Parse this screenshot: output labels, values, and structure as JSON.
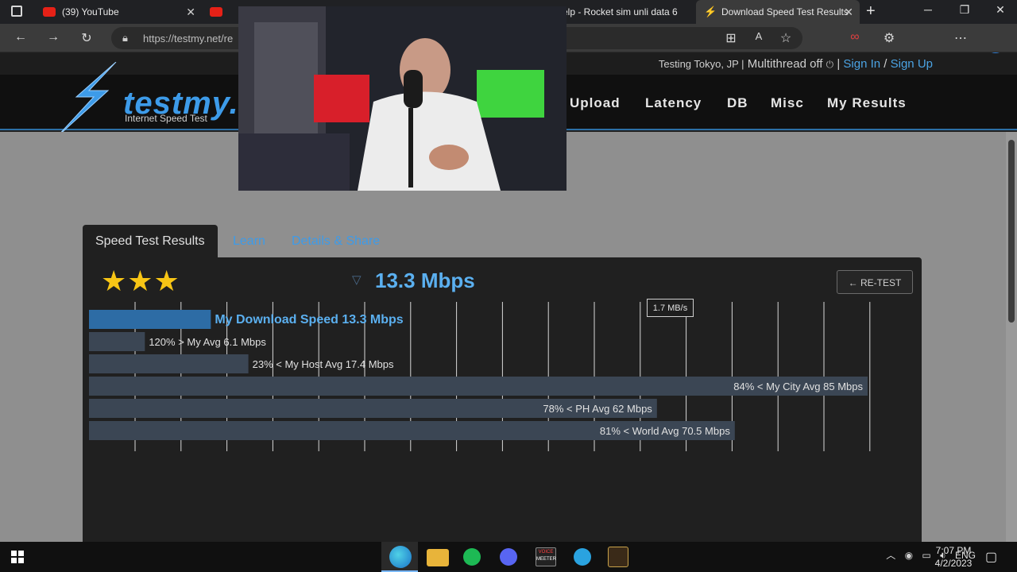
{
  "browser": {
    "tabs": [
      {
        "label": "(39) YouTube",
        "favicon": "youtube-icon"
      },
      {
        "label": "",
        "favicon": "youtube-icon"
      },
      {
        "label": "elp - Rocket sim unli data 6⁠",
        "favicon": ""
      },
      {
        "label": "Download Speed Test Results",
        "favicon": "testmy-icon"
      }
    ],
    "address": "https://testmy.net/re"
  },
  "site": {
    "status_prefix": "Testing Tokyo, JP |",
    "multithread": "Multithread off",
    "sign_in": "Sign In",
    "separator": "/",
    "sign_up": "Sign Up",
    "logo_text": "testmy.n",
    "logo_sub": "Internet Speed Test",
    "nav": [
      "Upload",
      "Latency",
      "DB",
      "Misc",
      "My Results"
    ]
  },
  "page": {
    "tabs": [
      "Speed Test Results",
      "Learn",
      "Details & Share"
    ],
    "stars": "★★★",
    "speed": "13.3 Mbps",
    "retest": "← RE-TEST",
    "tooltip": "1.7 MB/s"
  },
  "chart_data": {
    "type": "bar",
    "orientation": "horizontal",
    "categories": [
      "My Download Speed 13.3 Mbps",
      "120% > My Avg 6.1 Mbps",
      "23% < My Host Avg 17.4 Mbps",
      "84% < My City Avg 85 Mbps",
      "78% < PH Avg 62 Mbps",
      "81% < World Avg 70.5 Mbps"
    ],
    "values": [
      13.3,
      6.1,
      17.4,
      85,
      62,
      70.5
    ],
    "xlim": [
      0,
      85
    ],
    "grid": true,
    "colors": [
      "#2d6ca5",
      "#3b4654",
      "#3b4654",
      "#3b4654",
      "#3b4654",
      "#3b4654"
    ]
  },
  "taskbar": {
    "apps": [
      "edge-icon",
      "file-explorer-icon",
      "spotify-icon",
      "discord-icon",
      "voicemeeter-icon",
      "telegram-icon",
      "league-icon"
    ],
    "voicemeeter_label": "VOICE",
    "voicemeeter_label2": "MEETER",
    "lang": "ENG",
    "time": "7:07 PM",
    "date": "4/2/2023"
  }
}
